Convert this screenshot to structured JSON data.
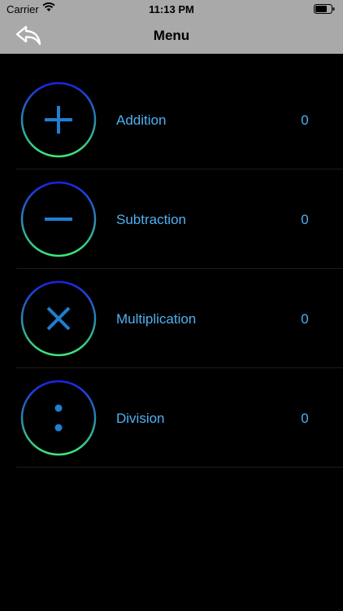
{
  "status_bar": {
    "carrier": "Carrier",
    "time": "11:13 PM"
  },
  "nav": {
    "title": "Menu",
    "back_icon": "back-arrow-icon"
  },
  "menu_items": [
    {
      "label": "Addition",
      "score": "0",
      "icon": "plus-icon"
    },
    {
      "label": "Subtraction",
      "score": "0",
      "icon": "minus-icon"
    },
    {
      "label": "Multiplication",
      "score": "0",
      "icon": "times-icon"
    },
    {
      "label": "Division",
      "score": "0",
      "icon": "divide-icon"
    }
  ],
  "colors": {
    "bar_background": "#a9a9a9",
    "background": "#000000",
    "accent_blue": "#1f7fd0",
    "text_blue": "#4fb0ef",
    "ring_top": "#1a23e6",
    "ring_bottom": "#3ee87a"
  }
}
